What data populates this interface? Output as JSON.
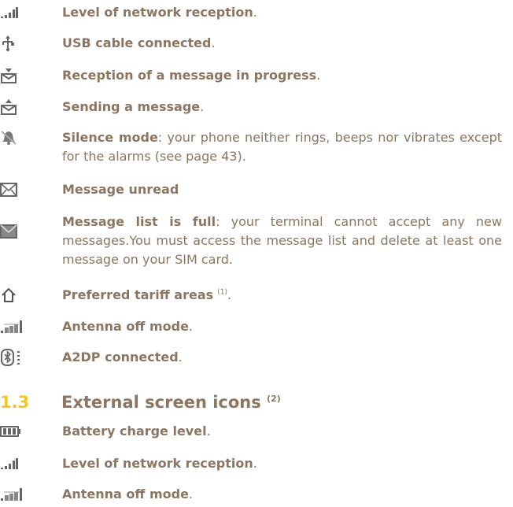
{
  "items": [
    {
      "bold": "Level of network reception",
      "rest": ".",
      "icon": "signal-bars-icon"
    },
    {
      "bold": "USB cable connected",
      "rest": ".",
      "icon": "usb-icon"
    },
    {
      "bold": "Reception of a message in progress",
      "rest": ".",
      "icon": "message-receiving-icon"
    },
    {
      "bold": "Sending a message",
      "rest": ".",
      "icon": "message-sending-icon"
    },
    {
      "bold": "Silence mode",
      "rest": ": your phone neither rings, beeps nor vibrates except for the alarms (see page 43).",
      "icon": "silence-mode-icon"
    },
    {
      "bold": "Message unread",
      "rest": "",
      "icon": "envelope-unread-icon"
    },
    {
      "bold": "Message list is full",
      "rest": ": your terminal cannot accept any new messages.You must access the message list and delete at least one message on your SIM card.",
      "icon": "envelope-full-icon"
    },
    {
      "bold": "Preferred tariff areas",
      "sup": "(1)",
      "rest": ".",
      "icon": "home-tariff-icon"
    },
    {
      "bold": "Antenna off mode",
      "rest": ".",
      "icon": "antenna-off-icon"
    },
    {
      "bold": "A2DP connected",
      "rest": ".",
      "icon": "bluetooth-a2dp-icon"
    }
  ],
  "section": {
    "number": "1.3",
    "title": "External screen icons",
    "sup": "(2)"
  },
  "external_items": [
    {
      "bold": "Battery charge level",
      "rest": ".",
      "icon": "battery-icon"
    },
    {
      "bold": "Level of network reception",
      "rest": ".",
      "icon": "signal-bars-icon"
    },
    {
      "bold": "Antenna off mode",
      "rest": ".",
      "icon": "antenna-off-icon"
    }
  ]
}
